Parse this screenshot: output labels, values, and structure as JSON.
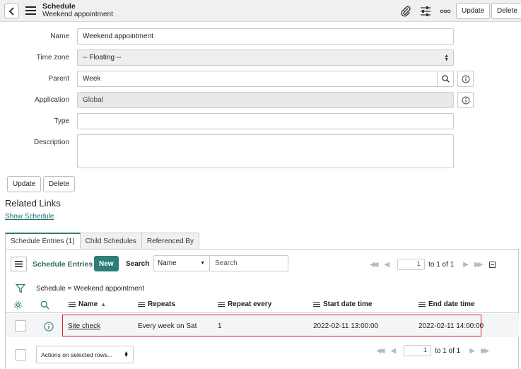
{
  "header": {
    "title": "Schedule",
    "subtitle": "Weekend appointment",
    "update_label": "Update",
    "delete_label": "Delete"
  },
  "form": {
    "name": {
      "label": "Name",
      "value": "Weekend appointment"
    },
    "time_zone": {
      "label": "Time zone",
      "value": "-- Floating --"
    },
    "parent": {
      "label": "Parent",
      "value": "Week"
    },
    "application": {
      "label": "Application",
      "value": "Global"
    },
    "type": {
      "label": "Type",
      "value": ""
    },
    "description": {
      "label": "Description",
      "value": ""
    },
    "update_label": "Update",
    "delete_label": "Delete"
  },
  "related": {
    "heading": "Related Links",
    "link": "Show Schedule"
  },
  "tabs": [
    {
      "label": "Schedule Entries (1)",
      "active": true
    },
    {
      "label": "Child Schedules",
      "active": false
    },
    {
      "label": "Referenced By",
      "active": false
    }
  ],
  "list": {
    "title": "Schedule Entries",
    "new_label": "New",
    "search_label": "Search",
    "search_field": "Name",
    "search_placeholder": "Search",
    "page_value": "1",
    "page_text": "to 1 of 1",
    "filter": "Schedule = Weekend appointment",
    "columns": [
      "Name",
      "Repeats",
      "Repeat every",
      "Start date time",
      "End date time"
    ],
    "sort_indicator": "▲",
    "rows": [
      {
        "name": "Site check",
        "repeats": "Every week on Sat",
        "repeat_every": "1",
        "start": "2022-02-11 13:00:00",
        "end": "2022-02-11 14:00:00"
      }
    ],
    "actions_label": "Actions on selected rows..."
  },
  "colors": {
    "accent": "#2e7d76",
    "highlight": "#d0202a"
  }
}
